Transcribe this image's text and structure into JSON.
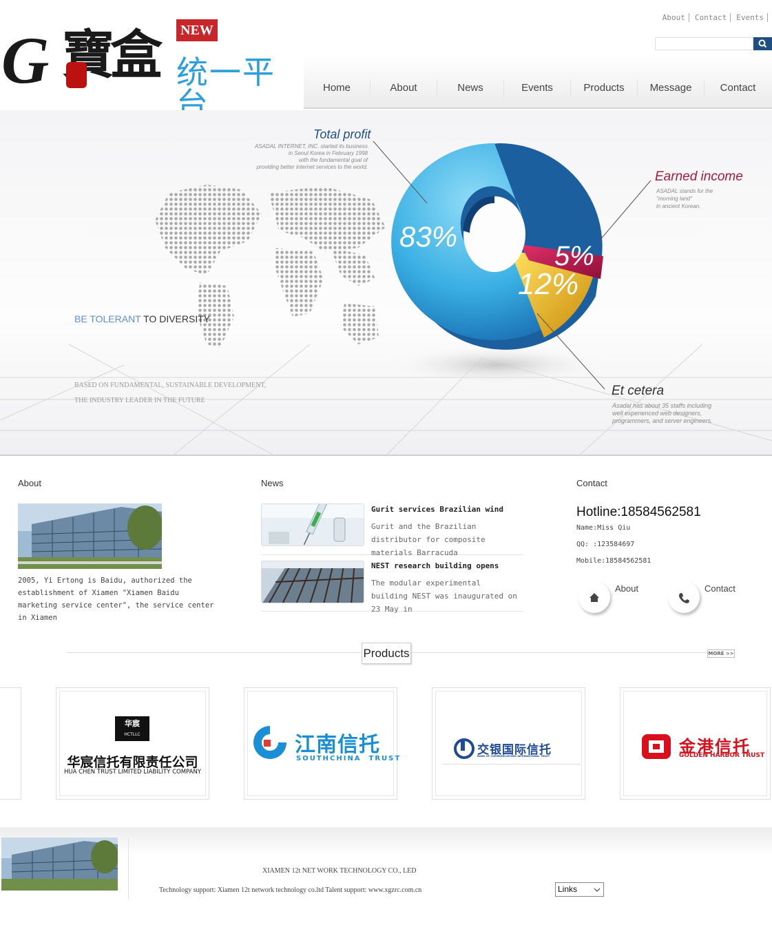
{
  "header": {
    "logo_text": "G寶盒",
    "logo_badge": "NEW",
    "logo_subtitle": "统一平台",
    "top_links": [
      "About",
      "Contact",
      "Events"
    ],
    "search_placeholder": ""
  },
  "nav": [
    "Home",
    "About",
    "News",
    "Events",
    "Products",
    "Message",
    "Contact"
  ],
  "banner": {
    "total_profit_title": "Total profit",
    "total_profit_desc": [
      "ASADAL INTERNET, INC. started its business",
      "in Seoul Korea in February 1998",
      "with the fundamental goal of",
      "providing better internet services to the world."
    ],
    "earned_income_title": "Earned income",
    "earned_income_desc": [
      "ASADAL stands for the",
      "\"morning land\"",
      "in ancient Korean."
    ],
    "et_cetera_title": "Et cetera",
    "et_cetera_desc": [
      "Asadal has about 35 staffs including",
      "well experienced web designers,",
      "programmers, and server engineers."
    ],
    "pct_1": "83%",
    "pct_2": "12%",
    "pct_3": "5%",
    "tagline_blue": "BE TOLERANT",
    "tagline_dark": "TO DIVERSITY",
    "slogan_1": "BASED ON FUNDAMENTAL, SUSTAINABLE DEVELOPMENT,",
    "slogan_2": "THE INDUSTRY LEADER IN THE FUTURE"
  },
  "about": {
    "title": "About",
    "text": "2005, Yi Ertong is Baidu, authorized the establishment of Xiamen \"Xiamen Baidu marketing service center\", the service center in Xiamen"
  },
  "news": {
    "title": "News",
    "items": [
      {
        "title": "Gurit services Brazilian wind",
        "desc": "Gurit and the Brazilian distributor for composite materials Barracuda"
      },
      {
        "title": "NEST research building opens",
        "desc": "The modular experimental building NEST was inaugurated on 23 May in"
      }
    ]
  },
  "contact": {
    "title": "Contact",
    "hotline": "Hotline:18584562581",
    "name": "Name:Miss Qiu",
    "qq": "QQ: :123584697",
    "mobile": "Mobile:18584562581",
    "about_link": "About",
    "contact_link": "Contact"
  },
  "products": {
    "title": "Products",
    "more": "MORE >>",
    "logos": [
      {
        "badge": "华宸",
        "sub": "HCTLLC",
        "cn": "华宸信托有限责任公司",
        "en": "HUA CHEN TRUST LIMITED LIABILITY COMPANY"
      },
      {
        "cn": "江南信托",
        "en": "SOUTHCHINA  TRUST"
      },
      {
        "cn": "交银国际信托",
        "en": "BANK OF COMMUNICATIONS INTERNATIONAL TRUST"
      },
      {
        "cn": "金港信托",
        "en": "GOLDEN HARBOR TRUST"
      }
    ]
  },
  "footer": {
    "company": "XIAMEN 12t NET WORK TECHNOLOGY CO., LED",
    "support": "Technology support: Xiamen 12t network technology co.ltd Talent support: www.xgzrc.com.cn",
    "links_select": "Links"
  },
  "colors": {
    "nav_bg": "#ebebeb",
    "search_btn": "#1f4f7f",
    "pie_blue": "#3fb1e3",
    "pie_yellow": "#f2b81a",
    "pie_red": "#b8174a"
  }
}
